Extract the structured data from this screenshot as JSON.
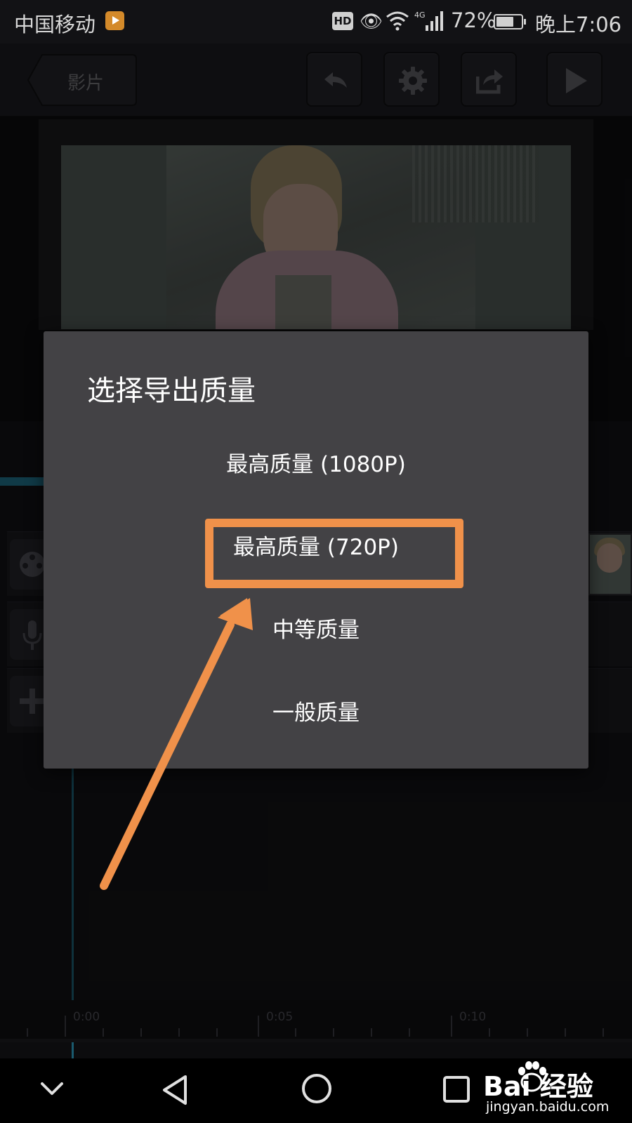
{
  "status_bar": {
    "carrier": "中国移动",
    "hd": "HD",
    "network": "4G",
    "battery_text": "72%",
    "battery_level": 0.72,
    "time": "晚上7:06"
  },
  "toolbar": {
    "back_label": "影片",
    "icons": [
      "undo-icon",
      "gear-icon",
      "share-icon",
      "play-icon"
    ]
  },
  "dialog": {
    "title": "选择导出质量",
    "options": [
      {
        "label": "最高质量 (1080P)"
      },
      {
        "label": "最高质量 (720P)"
      },
      {
        "label": "中等质量"
      },
      {
        "label": "一般质量"
      }
    ]
  },
  "timeline": {
    "ruler_labels": [
      "0:00",
      "0:05",
      "0:10"
    ]
  },
  "annotation": {
    "highlight_color": "#f0914a",
    "highlighted_option": "最高质量 (720P)"
  },
  "watermark": {
    "brand": "Bai  经验",
    "url": "jingyan.baidu.com"
  }
}
